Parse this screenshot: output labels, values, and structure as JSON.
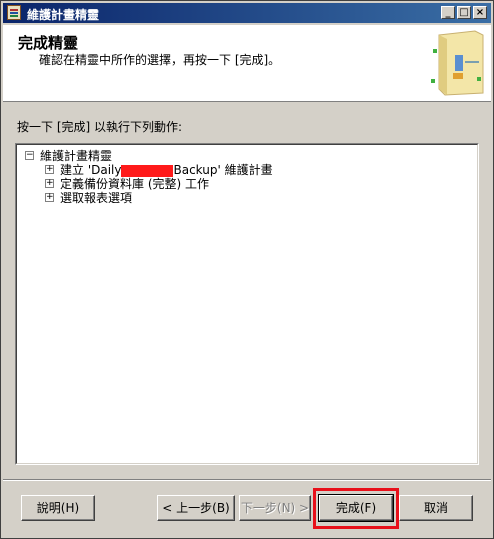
{
  "window": {
    "title": "維護計畫精靈",
    "controls": {
      "minimize": "_",
      "maximize": "□",
      "close": "×"
    }
  },
  "header": {
    "title": "完成精靈",
    "subtitle": "確認在精靈中所作的選擇，再按一下 [完成]。"
  },
  "instruction": "按一下 [完成] 以執行下列動作:",
  "tree": {
    "root": {
      "label": "維護計畫精靈",
      "expander": "−"
    },
    "items": [
      {
        "prefix": "建立 'Daily",
        "suffix": "Backup' 維護計畫",
        "expander": "+"
      },
      {
        "label": "定義備份資料庫 (完整) 工作",
        "expander": "+"
      },
      {
        "label": "選取報表選項",
        "expander": "+"
      }
    ]
  },
  "buttons": {
    "help": "說明(H)",
    "back": "< 上一步(B)",
    "next": "下一步(N) >",
    "finish": "完成(F)",
    "cancel": "取消"
  },
  "colors": {
    "titlebar_start": "#0a246a",
    "titlebar_end": "#3a6ea5",
    "highlight": "#e8101a",
    "redaction": "#ff1a1a"
  }
}
